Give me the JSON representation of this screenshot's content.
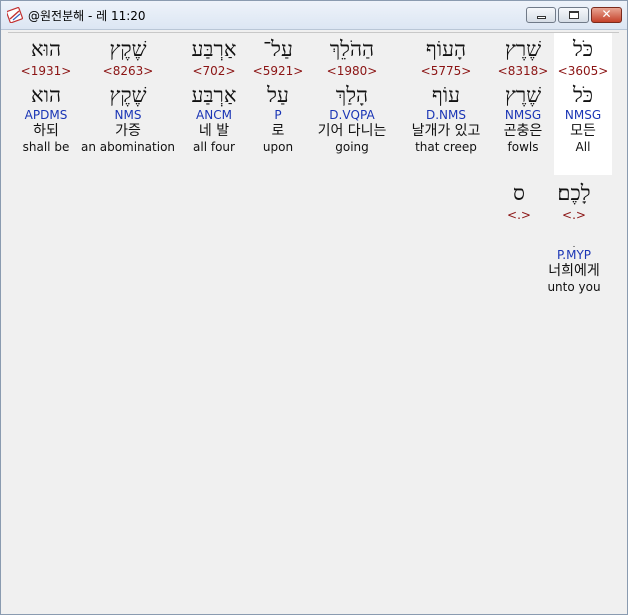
{
  "window": {
    "title": "@원전분해 - 레 11:20"
  },
  "row1": [
    {
      "heb": "הוּא",
      "strong": "<1931>",
      "heb2": "הוא",
      "parse": "APDMS",
      "korean": "하되",
      "english": "shall be"
    },
    {
      "heb": "שֶׁקֶץ",
      "strong": "<8263>",
      "heb2": "שֶׁקֶץ",
      "parse": "NMS",
      "korean": "가증",
      "english": "an abomination"
    },
    {
      "heb": "אַרְבַּע",
      "strong": "<702>",
      "heb2": "אַרְבַּע",
      "parse": "ANCM",
      "korean": "네 발",
      "english": "all four"
    },
    {
      "heb": "עַל־",
      "strong": "<5921>",
      "heb2": "עַל",
      "parse": "P",
      "korean": "로",
      "english": "upon"
    },
    {
      "heb": "הַהֹלֵךְ",
      "strong": "<1980>",
      "heb2": "הָלַךְ",
      "parse": "D.VQPA",
      "korean": "기어 다니는",
      "english": "going"
    },
    {
      "heb": "הָעוֹף",
      "strong": "<5775>",
      "heb2": "עוֹף",
      "parse": "D.NMS",
      "korean": "날개가 있고",
      "english": "that creep"
    },
    {
      "heb": "שֶׁרֶץ",
      "strong": "<8318>",
      "heb2": "שֶׁרֶץ",
      "parse": "NMSG",
      "korean": "곤충은",
      "english": "fowls"
    },
    {
      "heb": "כֹּל",
      "strong": "<3605>",
      "heb2": "כֹּל",
      "parse": "NMSG",
      "korean": "모든",
      "english": "All"
    }
  ],
  "row2": [
    {
      "heb": "ס",
      "strong": "<.>",
      "heb2": "",
      "parse": "",
      "korean": "",
      "english": ""
    },
    {
      "heb": "לָכֶם׃",
      "strong": "<.>",
      "heb2": "ׅ",
      "parse": "P.MYP",
      "korean": "너희에게",
      "english": "unto you"
    }
  ]
}
